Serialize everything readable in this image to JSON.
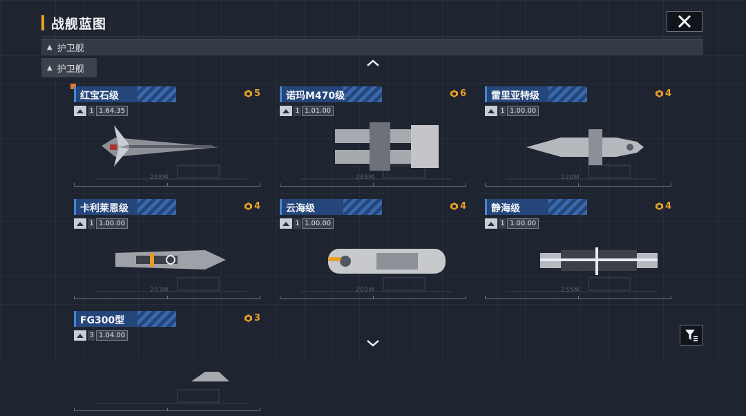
{
  "header": {
    "title": "战舰蓝图"
  },
  "category": {
    "label": "护卫舰"
  },
  "subcategory": {
    "label": "护卫舰"
  },
  "colors": {
    "accent": "#e8a02a",
    "name_bar": "#25467a",
    "background": "#1f2530"
  },
  "icons": {
    "close": "close-icon",
    "scroll_up": "chevron-up-icon",
    "scroll_down": "chevron-down-icon",
    "filter": "filter-icon",
    "cost": "resource-icon"
  },
  "ships": [
    {
      "name": "红宝石级",
      "cost": "5",
      "count": "1",
      "version": "1.64.35",
      "size": "288M",
      "is_new": true
    },
    {
      "name": "诺玛M470级",
      "cost": "6",
      "count": "1",
      "version": "1.01.00",
      "size": "286M",
      "is_new": false
    },
    {
      "name": "雷里亚特级",
      "cost": "4",
      "count": "1",
      "version": "1.00.00",
      "size": "220M",
      "is_new": false
    },
    {
      "name": "卡利莱恩级",
      "cost": "4",
      "count": "1",
      "version": "1.00.00",
      "size": "203M",
      "is_new": false
    },
    {
      "name": "云海级",
      "cost": "4",
      "count": "1",
      "version": "1.00.00",
      "size": "202M",
      "is_new": false
    },
    {
      "name": "静海级",
      "cost": "4",
      "count": "1",
      "version": "1.00.00",
      "size": "255M",
      "is_new": false
    },
    {
      "name": "FG300型",
      "cost": "3",
      "count": "3",
      "version": "1.04.00",
      "size": "",
      "is_new": false
    }
  ]
}
